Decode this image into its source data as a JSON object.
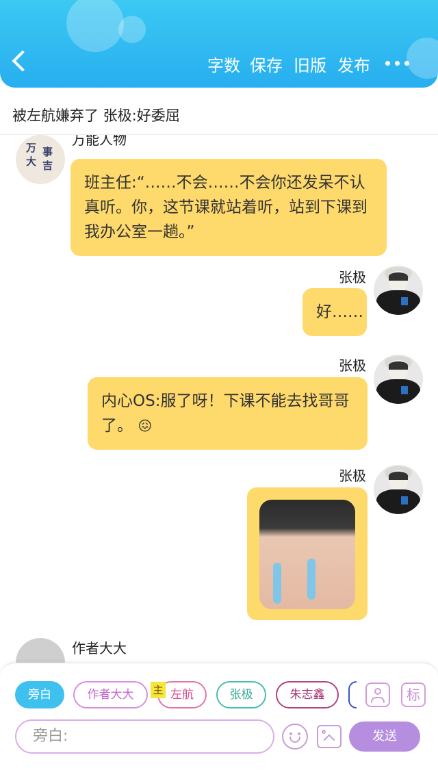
{
  "header": {
    "actions": [
      "字数",
      "保存",
      "旧版",
      "发布"
    ]
  },
  "title": "被左航嫌弃了 张极:好委屈",
  "messages": [
    {
      "sender": "万能人物",
      "text": "班主任:“……不会……不会你还发呆不认真听。你，这节课就站着听，站到下课到我办公室一趟。”"
    },
    {
      "sender": "张极",
      "text": "好……"
    },
    {
      "sender": "张极",
      "text": "内心OS:服了呀！下课不能去找哥哥了。"
    },
    {
      "sender": "张极",
      "text": ""
    },
    {
      "sender": "作者大大",
      "text": ""
    }
  ],
  "avatar_text": {
    "chars": [
      "万",
      "事",
      "大",
      "吉"
    ]
  },
  "emoji": "😖",
  "chips": [
    {
      "label": "旁白",
      "selected": true
    },
    {
      "label": "作者大大"
    },
    {
      "label": "左航",
      "badge": "主"
    },
    {
      "label": "张极"
    },
    {
      "label": "朱志鑫"
    }
  ],
  "icons": {
    "tag_label": "标"
  },
  "input": {
    "placeholder": "旁白:"
  },
  "send_label": "发送",
  "colors": {
    "accent": "#29b3f0",
    "bubble": "#fed96c",
    "send": "#b58ee0"
  }
}
